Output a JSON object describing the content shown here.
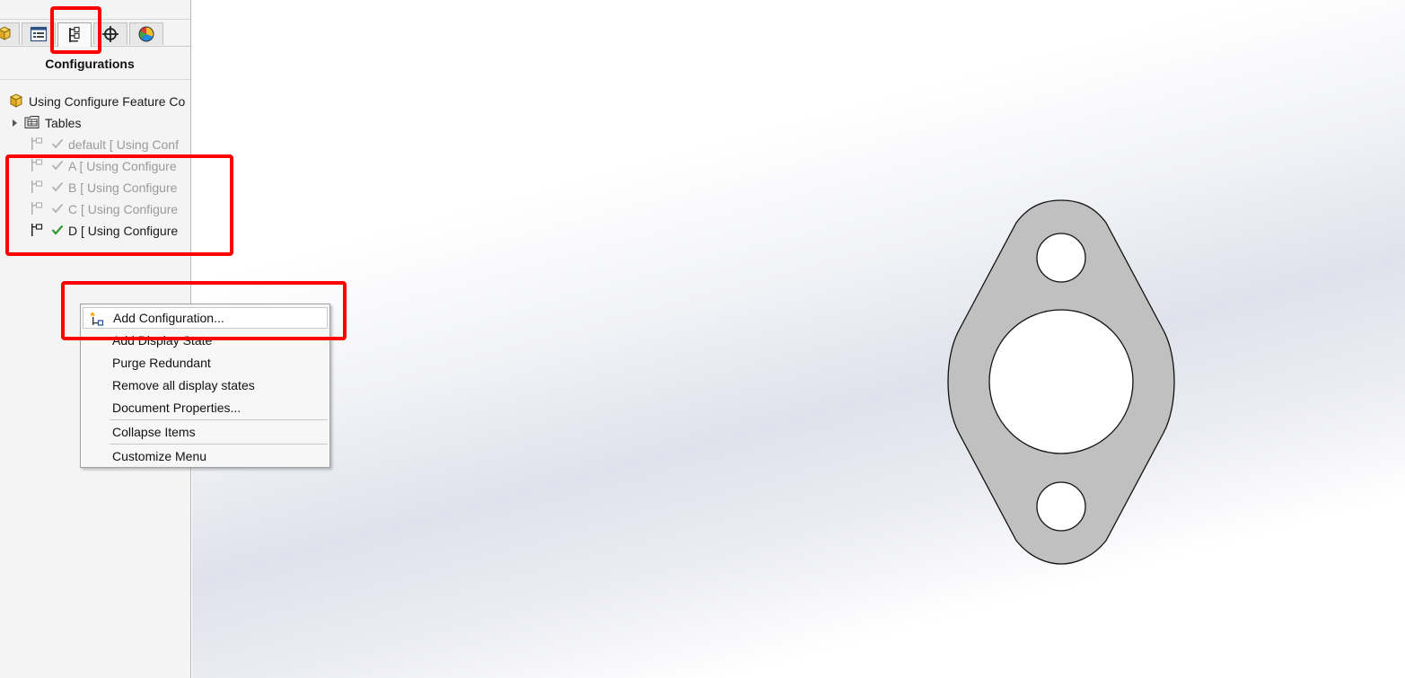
{
  "panel": {
    "title": "Configurations",
    "tabs": [
      {
        "icon": "feature-manager-icon"
      },
      {
        "icon": "property-manager-icon"
      },
      {
        "icon": "configuration-manager-icon",
        "active": true
      },
      {
        "icon": "dimxpert-manager-icon"
      },
      {
        "icon": "display-manager-icon"
      }
    ],
    "tree": {
      "root": "Using Configure Feature Co",
      "tables": "Tables",
      "configs": [
        {
          "label": "default [ Using Conf",
          "active": false
        },
        {
          "label": "A [ Using Configure",
          "active": false
        },
        {
          "label": "B [ Using Configure",
          "active": false
        },
        {
          "label": "C [ Using Configure",
          "active": false
        },
        {
          "label": "D [ Using Configure",
          "active": true
        }
      ]
    }
  },
  "context_menu": {
    "items": [
      {
        "label": "Add Configuration...",
        "highlighted": true
      },
      {
        "label": "Add Display State"
      },
      {
        "label": "Purge Redundant"
      },
      {
        "label": "Remove all display states"
      },
      {
        "label": "Document Properties..."
      },
      {
        "label": "Collapse Items"
      },
      {
        "label": "Customize Menu"
      }
    ]
  },
  "colors": {
    "annotation": "#ff0000",
    "part_fill": "#c0c0c0",
    "check_active": "#2e9a2e",
    "check_inactive": "#b5b5b5"
  }
}
